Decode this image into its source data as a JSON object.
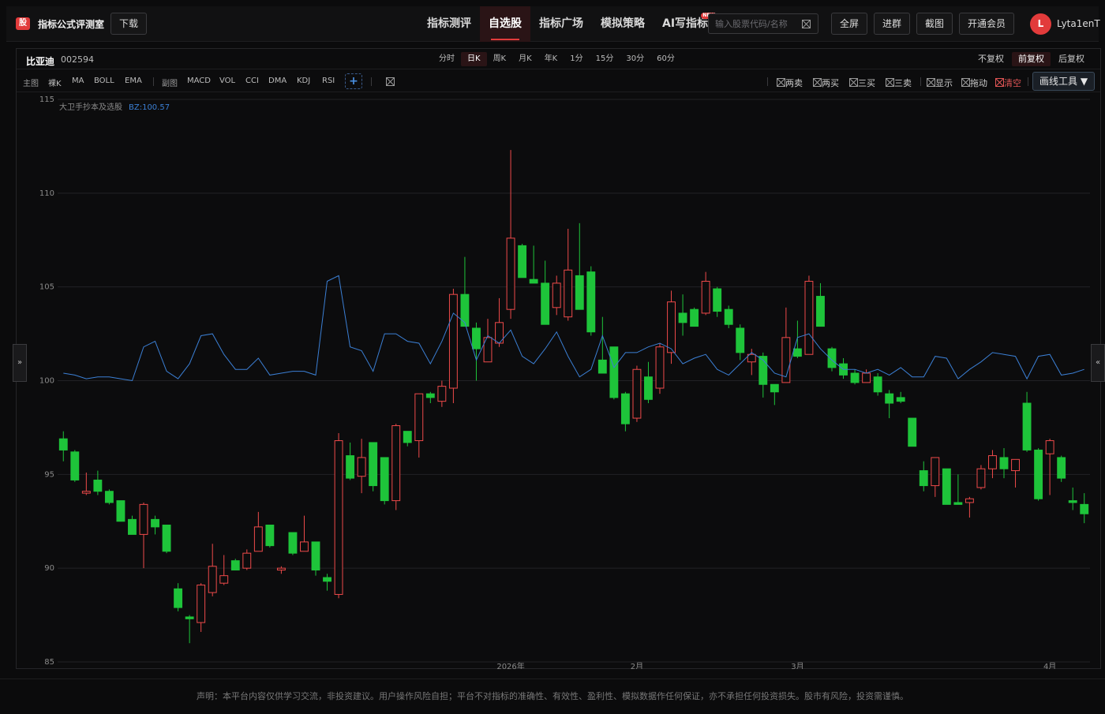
{
  "app": {
    "logo_char": "股",
    "title": "指标公式评测室",
    "download_label": "下载"
  },
  "nav": {
    "items": [
      {
        "label": "指标测评",
        "active": false
      },
      {
        "label": "自选股",
        "active": true
      },
      {
        "label": "指标广场",
        "active": false
      },
      {
        "label": "模拟策略",
        "active": false
      },
      {
        "label": "AI写指标",
        "active": false,
        "badge": "NEW"
      }
    ]
  },
  "search": {
    "placeholder": "输入股票代码/名称",
    "value": ""
  },
  "toolbar": {
    "fullscreen_label": "全屏",
    "join_group_label": "进群",
    "screenshot_label": "截图",
    "vip_label": "开通会员"
  },
  "user": {
    "avatar_letter": "L",
    "name": "Lyta1enT"
  },
  "stock": {
    "name": "比亚迪",
    "code": "002594"
  },
  "periods": [
    {
      "label": "分时",
      "active": false
    },
    {
      "label": "日K",
      "active": true
    },
    {
      "label": "周K",
      "active": false
    },
    {
      "label": "月K",
      "active": false
    },
    {
      "label": "年K",
      "active": false
    },
    {
      "label": "1分",
      "active": false
    },
    {
      "label": "15分",
      "active": false
    },
    {
      "label": "30分",
      "active": false
    },
    {
      "label": "60分",
      "active": false
    }
  ],
  "adjustments": [
    {
      "label": "不复权",
      "active": false
    },
    {
      "label": "前复权",
      "active": true
    },
    {
      "label": "后复权",
      "active": false
    }
  ],
  "indicators": {
    "main_label": "主图",
    "main": [
      "裸K",
      "MA",
      "BOLL",
      "EMA"
    ],
    "sub_label": "副图",
    "sub": [
      "MACD",
      "VOL",
      "CCI",
      "DMA",
      "KDJ",
      "RSI"
    ],
    "add_label": "+"
  },
  "signal_tools": [
    {
      "label": "两卖",
      "red": false
    },
    {
      "label": "两买",
      "red": false
    },
    {
      "label": "三买",
      "red": false
    },
    {
      "label": "三卖",
      "red": false
    },
    {
      "label": "显示",
      "red": false
    },
    {
      "label": "拖动",
      "red": false
    },
    {
      "label": "清空",
      "red": true
    }
  ],
  "draw_tools_label": "画线工具",
  "side_arrows": {
    "left": "»",
    "right": "«"
  },
  "footer": {
    "disclaimer": "声明：本平台内容仅供学习交流，非投资建议。用户操作风险自担；平台不对指标的准确性、有效性、盈利性、模拟数据作任何保证，亦不承担任何投资损失。股市有风险，投资需谨慎。"
  },
  "colors": {
    "up": "#ee4a4a",
    "down": "#1ec43a",
    "line": "#3b7fd4",
    "accent": "#e23b3b"
  },
  "chart_data": {
    "type": "candlestick",
    "indicator_name": "大卫手抄本及选股",
    "indicator_label": "BZ:100.57",
    "ylim": [
      85,
      115
    ],
    "y_ticks": [
      115,
      110,
      105,
      100,
      95,
      90,
      85
    ],
    "x_tick_labels": [
      {
        "label": "2026年",
        "index": 39
      },
      {
        "label": "2月",
        "index": 50
      },
      {
        "label": "3月",
        "index": 64
      },
      {
        "label": "4月",
        "index": 86
      }
    ],
    "candles": [
      [
        96.9,
        96.3,
        97.3,
        95.7
      ],
      [
        96.2,
        94.7,
        96.3,
        94.6
      ],
      [
        94.0,
        94.1,
        95.1,
        93.9
      ],
      [
        94.7,
        94.1,
        95.2,
        93.9
      ],
      [
        94.1,
        93.5,
        94.2,
        93.4
      ],
      [
        93.6,
        92.5,
        93.6,
        92.5
      ],
      [
        92.6,
        91.8,
        92.8,
        91.8
      ],
      [
        91.8,
        93.4,
        93.5,
        90.0
      ],
      [
        92.6,
        92.2,
        92.8,
        91.8
      ],
      [
        92.3,
        90.9,
        92.3,
        90.8
      ],
      [
        88.9,
        87.9,
        89.2,
        87.7
      ],
      [
        87.4,
        87.3,
        87.5,
        86.0
      ],
      [
        87.1,
        89.1,
        89.2,
        86.6
      ],
      [
        88.7,
        90.1,
        91.3,
        88.5
      ],
      [
        89.2,
        89.6,
        90.7,
        89.1
      ],
      [
        90.4,
        89.9,
        90.5,
        89.9
      ],
      [
        90.0,
        90.8,
        91.0,
        89.9
      ],
      [
        90.9,
        92.2,
        93.0,
        90.9
      ],
      [
        92.3,
        91.2,
        92.3,
        91.1
      ],
      [
        89.9,
        90.0,
        90.1,
        89.7
      ],
      [
        91.9,
        90.8,
        91.9,
        90.7
      ],
      [
        90.9,
        91.4,
        92.8,
        90.9
      ],
      [
        91.4,
        89.9,
        91.4,
        89.6
      ],
      [
        89.5,
        89.3,
        89.7,
        88.8
      ],
      [
        88.6,
        96.8,
        97.2,
        88.4
      ],
      [
        96.0,
        94.8,
        96.7,
        94.7
      ],
      [
        94.9,
        95.9,
        96.9,
        94.0
      ],
      [
        96.7,
        94.4,
        96.7,
        94.1
      ],
      [
        95.9,
        93.6,
        95.9,
        93.4
      ],
      [
        93.6,
        97.6,
        97.7,
        93.1
      ],
      [
        97.3,
        96.7,
        97.3,
        96.5
      ],
      [
        96.8,
        99.3,
        99.3,
        95.9
      ],
      [
        99.3,
        99.1,
        99.4,
        98.8
      ],
      [
        98.9,
        99.7,
        100.0,
        98.6
      ],
      [
        99.6,
        104.6,
        104.9,
        98.8
      ],
      [
        104.6,
        102.9,
        106.6,
        102.9
      ],
      [
        102.8,
        101.7,
        103.1,
        100.0
      ],
      [
        101.0,
        102.3,
        103.3,
        101.0
      ],
      [
        102.0,
        103.1,
        104.4,
        101.8
      ],
      [
        103.8,
        107.6,
        112.3,
        103.3
      ],
      [
        107.2,
        105.5,
        107.3,
        105.5
      ],
      [
        105.4,
        105.2,
        107.2,
        105.2
      ],
      [
        105.2,
        103.0,
        106.4,
        103.0
      ],
      [
        103.9,
        105.2,
        105.6,
        103.5
      ],
      [
        103.4,
        105.9,
        108.1,
        103.2
      ],
      [
        105.6,
        103.8,
        108.4,
        103.8
      ],
      [
        105.8,
        102.6,
        106.1,
        102.4
      ],
      [
        101.1,
        100.4,
        103.4,
        100.4
      ],
      [
        101.8,
        99.1,
        101.8,
        99.0
      ],
      [
        99.3,
        97.7,
        99.4,
        97.3
      ],
      [
        98.0,
        100.6,
        100.8,
        97.8
      ],
      [
        100.2,
        99.0,
        101.0,
        98.8
      ],
      [
        99.6,
        101.8,
        102.0,
        99.3
      ],
      [
        101.5,
        104.2,
        104.8,
        100.9
      ],
      [
        103.6,
        103.1,
        104.6,
        102.4
      ],
      [
        103.8,
        102.9,
        103.9,
        102.9
      ],
      [
        103.6,
        105.3,
        105.8,
        103.5
      ],
      [
        104.9,
        103.7,
        105.0,
        103.4
      ],
      [
        103.8,
        103.0,
        104.0,
        102.8
      ],
      [
        102.8,
        101.5,
        103.0,
        101.1
      ],
      [
        101.0,
        101.4,
        101.7,
        100.3
      ],
      [
        101.3,
        99.8,
        101.5,
        99.1
      ],
      [
        99.8,
        99.4,
        99.8,
        98.7
      ],
      [
        99.9,
        102.3,
        103.9,
        99.9
      ],
      [
        101.7,
        101.3,
        103.2,
        101.2
      ],
      [
        101.4,
        105.3,
        105.6,
        101.4
      ],
      [
        104.5,
        102.9,
        105.2,
        102.9
      ],
      [
        101.7,
        100.7,
        101.8,
        100.5
      ],
      [
        100.9,
        100.3,
        101.2,
        100.1
      ],
      [
        100.4,
        99.9,
        100.6,
        99.8
      ],
      [
        99.9,
        100.4,
        100.6,
        99.9
      ],
      [
        100.2,
        99.4,
        100.4,
        99.2
      ],
      [
        99.3,
        98.8,
        99.5,
        98.0
      ],
      [
        99.1,
        98.9,
        99.4,
        98.8
      ],
      [
        98.0,
        96.5,
        98.0,
        96.5
      ],
      [
        95.2,
        94.4,
        95.7,
        94.1
      ],
      [
        94.4,
        95.9,
        95.9,
        93.8
      ],
      [
        95.3,
        93.4,
        95.3,
        93.4
      ],
      [
        93.5,
        93.4,
        95.0,
        93.4
      ],
      [
        93.5,
        93.7,
        93.8,
        92.7
      ],
      [
        94.3,
        95.3,
        95.5,
        94.2
      ],
      [
        95.3,
        96.0,
        96.3,
        94.8
      ],
      [
        95.9,
        95.3,
        96.4,
        94.8
      ],
      [
        95.2,
        95.8,
        95.8,
        94.3
      ],
      [
        98.8,
        96.3,
        99.4,
        96.2
      ],
      [
        96.3,
        93.7,
        96.4,
        93.6
      ],
      [
        96.1,
        96.8,
        96.9,
        93.9
      ],
      [
        95.9,
        94.8,
        96.0,
        94.6
      ],
      [
        93.6,
        93.5,
        94.3,
        93.1
      ],
      [
        93.4,
        92.9,
        94.0,
        92.4
      ]
    ],
    "indicator_values": [
      100.4,
      100.3,
      100.1,
      100.2,
      100.2,
      100.1,
      100.0,
      101.8,
      102.1,
      100.5,
      100.1,
      100.9,
      102.4,
      102.5,
      101.4,
      100.6,
      100.6,
      101.2,
      100.3,
      100.4,
      100.5,
      100.5,
      100.3,
      105.3,
      105.6,
      101.8,
      101.6,
      100.5,
      102.5,
      102.5,
      102.1,
      102.0,
      100.9,
      102.1,
      103.6,
      103.1,
      101.1,
      102.4,
      102.0,
      102.7,
      101.3,
      100.9,
      101.7,
      102.6,
      101.3,
      100.2,
      100.6,
      102.4,
      100.7,
      101.5,
      101.5,
      101.8,
      102.0,
      101.7,
      100.9,
      101.2,
      101.4,
      100.6,
      100.3,
      100.9,
      101.5,
      101.1,
      100.4,
      100.2,
      102.3,
      102.5,
      101.7,
      101.1,
      100.6,
      100.6,
      100.4,
      100.6,
      100.3,
      100.7,
      100.2,
      100.2,
      101.3,
      101.2,
      100.1,
      100.6,
      101.0,
      101.5,
      101.4,
      101.3,
      100.1,
      101.3,
      101.4,
      100.3,
      100.4,
      100.6
    ]
  }
}
